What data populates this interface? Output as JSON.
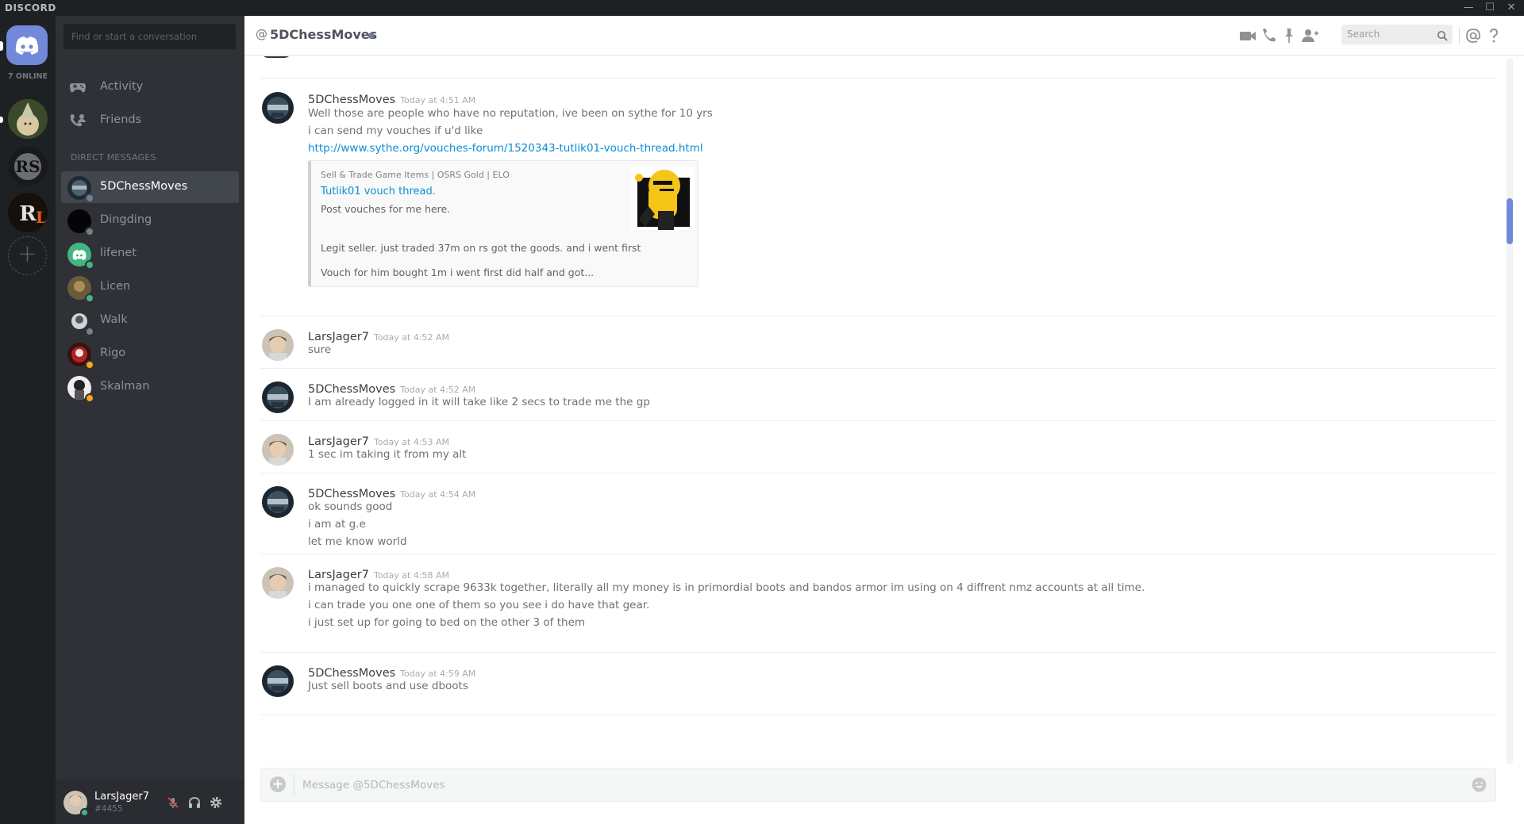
{
  "titlebar": {
    "app_name": "DISCORD",
    "minimize": "—",
    "maximize": "☐",
    "close": "✕"
  },
  "guilds": {
    "online_count": "7 ONLINE",
    "icons": [
      "discord-home-icon",
      "guild-elf",
      "guild-rs",
      "guild-rl",
      "add-guild"
    ]
  },
  "sidebar": {
    "search_placeholder": "Find or start a conversation",
    "nav": [
      {
        "label": "Activity",
        "icon": "gamepad-icon"
      },
      {
        "label": "Friends",
        "icon": "friends-icon"
      }
    ],
    "dm_header": "DIRECT MESSAGES",
    "dms": [
      {
        "name": "5DChessMoves",
        "status": "#747f8d",
        "active": true
      },
      {
        "name": "Dingding",
        "status": "#747f8d"
      },
      {
        "name": "lifenet",
        "status": "#43b581"
      },
      {
        "name": "Licen",
        "status": "#43b581"
      },
      {
        "name": "Walk",
        "status": "#747f8d"
      },
      {
        "name": "Rigo",
        "status": "#faa61a"
      },
      {
        "name": "Skalman",
        "status": "#faa61a"
      }
    ]
  },
  "user": {
    "name": "LarsJager7",
    "tag": "#4455",
    "status": "#43b581"
  },
  "header": {
    "at": "@",
    "channel": "5DChessMoves",
    "search_placeholder": "Search"
  },
  "messages": [
    {
      "user": "5DChessMoves",
      "time": "Today at 4:51 AM",
      "lines": [
        "Well those are people who have no reputation, ive been on sythe for 10 yrs",
        "i can send my vouches if u'd like"
      ],
      "link": "http://www.sythe.org/vouches-forum/1520343-tutlik01-vouch-thread.html",
      "embed": {
        "provider": "Sell & Trade Game Items | OSRS Gold | ELO",
        "title": "Tutlik01 vouch thread.",
        "description": "Post vouches for me here.",
        "field1": "Legit seller. just traded 37m on rs got the goods. and i went first",
        "field2": "Vouch for him bought 1m i went first did half and got..."
      }
    },
    {
      "user": "LarsJager7",
      "time": "Today at 4:52 AM",
      "lines": [
        "sure"
      ]
    },
    {
      "user": "5DChessMoves",
      "time": "Today at 4:52 AM",
      "lines": [
        "I am already logged in it will take like 2 secs to trade me the gp"
      ]
    },
    {
      "user": "LarsJager7",
      "time": "Today at 4:53 AM",
      "lines": [
        "1 sec im taking it from my alt"
      ]
    },
    {
      "user": "5DChessMoves",
      "time": "Today at 4:54 AM",
      "lines": [
        "ok sounds good",
        "i am at g.e",
        "let me know world"
      ]
    },
    {
      "user": "LarsJager7",
      "time": "Today at 4:58 AM",
      "lines": [
        "i managed to quickly scrape 9633k together, literally all my money is in primordial boots and bandos armor im using on 4 diffrent nmz accounts at all time.",
        "i can trade you one one of them so you see i do have that gear.",
        "i just set up for going to bed on the other 3 of them"
      ]
    },
    {
      "user": "5DChessMoves",
      "time": "Today at 4:59 AM",
      "lines": [
        "Just sell boots and use dboots"
      ]
    }
  ],
  "composer": {
    "placeholder": "Message @5DChessMoves"
  },
  "colors": {
    "accent": "#7289da",
    "link": "#0a8ed6",
    "online": "#43b581",
    "idle": "#faa61a",
    "offline": "#747f8d"
  }
}
